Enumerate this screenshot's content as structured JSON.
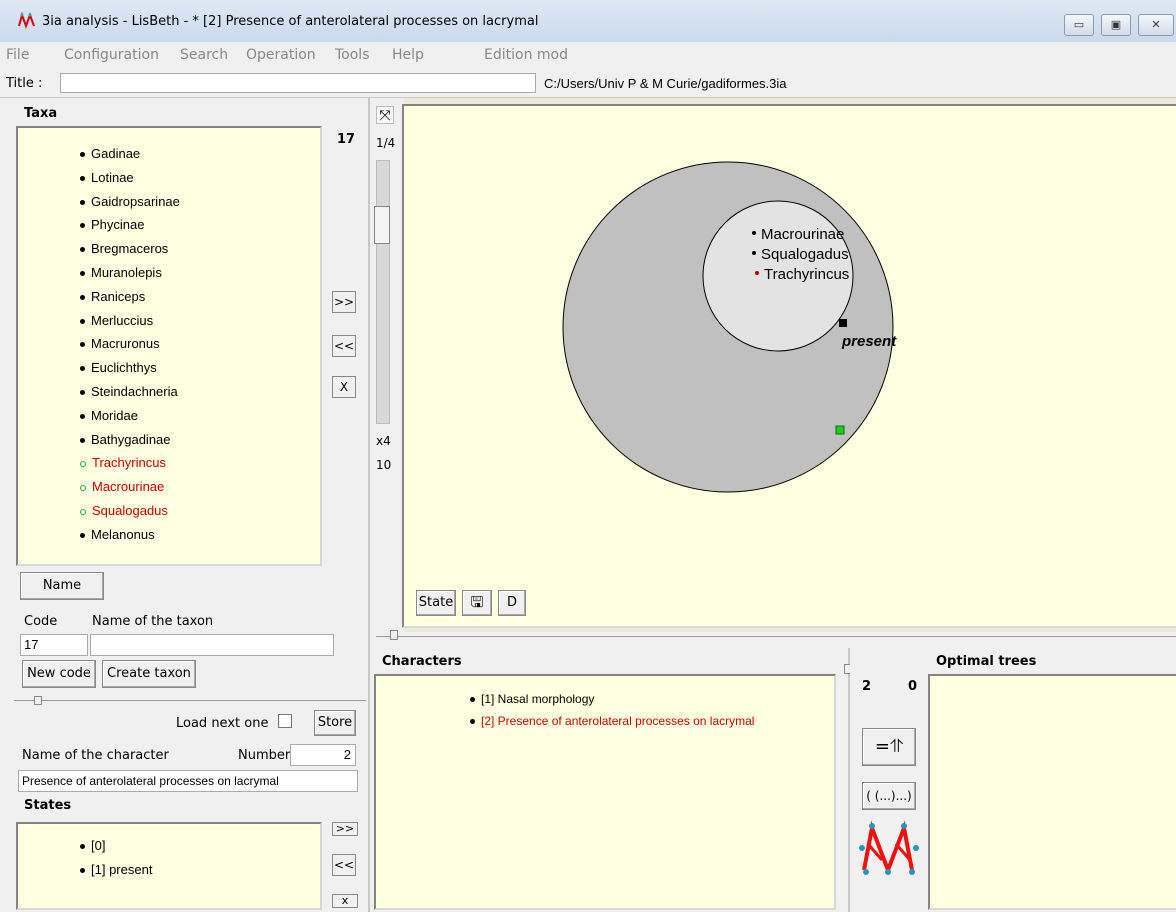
{
  "window": {
    "title": "3ia analysis - LisBeth - * [2] Presence of anterolateral  processes on lacrymal"
  },
  "menu": [
    "File",
    "Configuration",
    "Search",
    "Operation",
    "Tools",
    "Help",
    "Edition mod"
  ],
  "title_row": {
    "label": "Title :",
    "value": "",
    "path": "C:/Users/Univ P & M Curie/gadiformes.3ia"
  },
  "taxa": {
    "heading": "Taxa",
    "count": "17",
    "items": [
      {
        "label": "Gadinae",
        "highlight": false
      },
      {
        "label": "Lotinae",
        "highlight": false
      },
      {
        "label": "Gaidropsarinae",
        "highlight": false
      },
      {
        "label": "Phycinae",
        "highlight": false
      },
      {
        "label": "Bregmaceros",
        "highlight": false
      },
      {
        "label": "Muranolepis",
        "highlight": false
      },
      {
        "label": "Raniceps",
        "highlight": false
      },
      {
        "label": "Merluccius",
        "highlight": false
      },
      {
        "label": "Macruronus",
        "highlight": false
      },
      {
        "label": "Euclichthys",
        "highlight": false
      },
      {
        "label": "Steindachneria",
        "highlight": false
      },
      {
        "label": "Moridae",
        "highlight": false
      },
      {
        "label": "Bathygadinae",
        "highlight": false
      },
      {
        "label": "Trachyrincus",
        "highlight": true
      },
      {
        "label": "Macrourinae",
        "highlight": true
      },
      {
        "label": "Squalogadus",
        "highlight": true
      },
      {
        "label": "Melanonus",
        "highlight": false
      }
    ],
    "add_btn": ">>",
    "remove_btn": "<<",
    "clear_btn": "X",
    "name_btn": "Name",
    "code_label": "Code",
    "name_label": "Name of the taxon",
    "code_value": "17",
    "name_value": "",
    "new_code_btn": "New code",
    "create_btn": "Create taxon"
  },
  "zoom": {
    "page": "1/4",
    "factor": "x4",
    "level": "10"
  },
  "venn": {
    "outer_labels": [],
    "inner_labels": [
      "Macrourinae",
      "Squalogadus",
      "Trachyrincus"
    ],
    "state_label": "present",
    "colors": {
      "outer": "#c0c0c0",
      "inner": "#e3e3e3",
      "canvas": "#ffffe1",
      "green": "#22cc22"
    }
  },
  "canvas_buttons": {
    "state": "State",
    "d": "D"
  },
  "character_form": {
    "load_next_label": "Load next one",
    "store_btn": "Store",
    "name_label": "Name of the character",
    "number_label": "Number",
    "number_value": "2",
    "name_value": "Presence of anterolateral  processes on lacrymal",
    "states_heading": "States",
    "states": [
      "[0]",
      "[1] present"
    ],
    "states_add": ">>",
    "states_remove": "<<",
    "states_clear": "x"
  },
  "characters": {
    "heading": "Characters",
    "items": [
      {
        "label": "[1] Nasal morphology",
        "highlight": false
      },
      {
        "label": "[2] Presence of anterolateral  processes on lacrymal",
        "highlight": true
      }
    ]
  },
  "trees": {
    "heading": "Optimal trees",
    "count_a": "2",
    "count_b": "0",
    "btn_up": "=⥣",
    "btn_paren": "( (...)...)"
  }
}
